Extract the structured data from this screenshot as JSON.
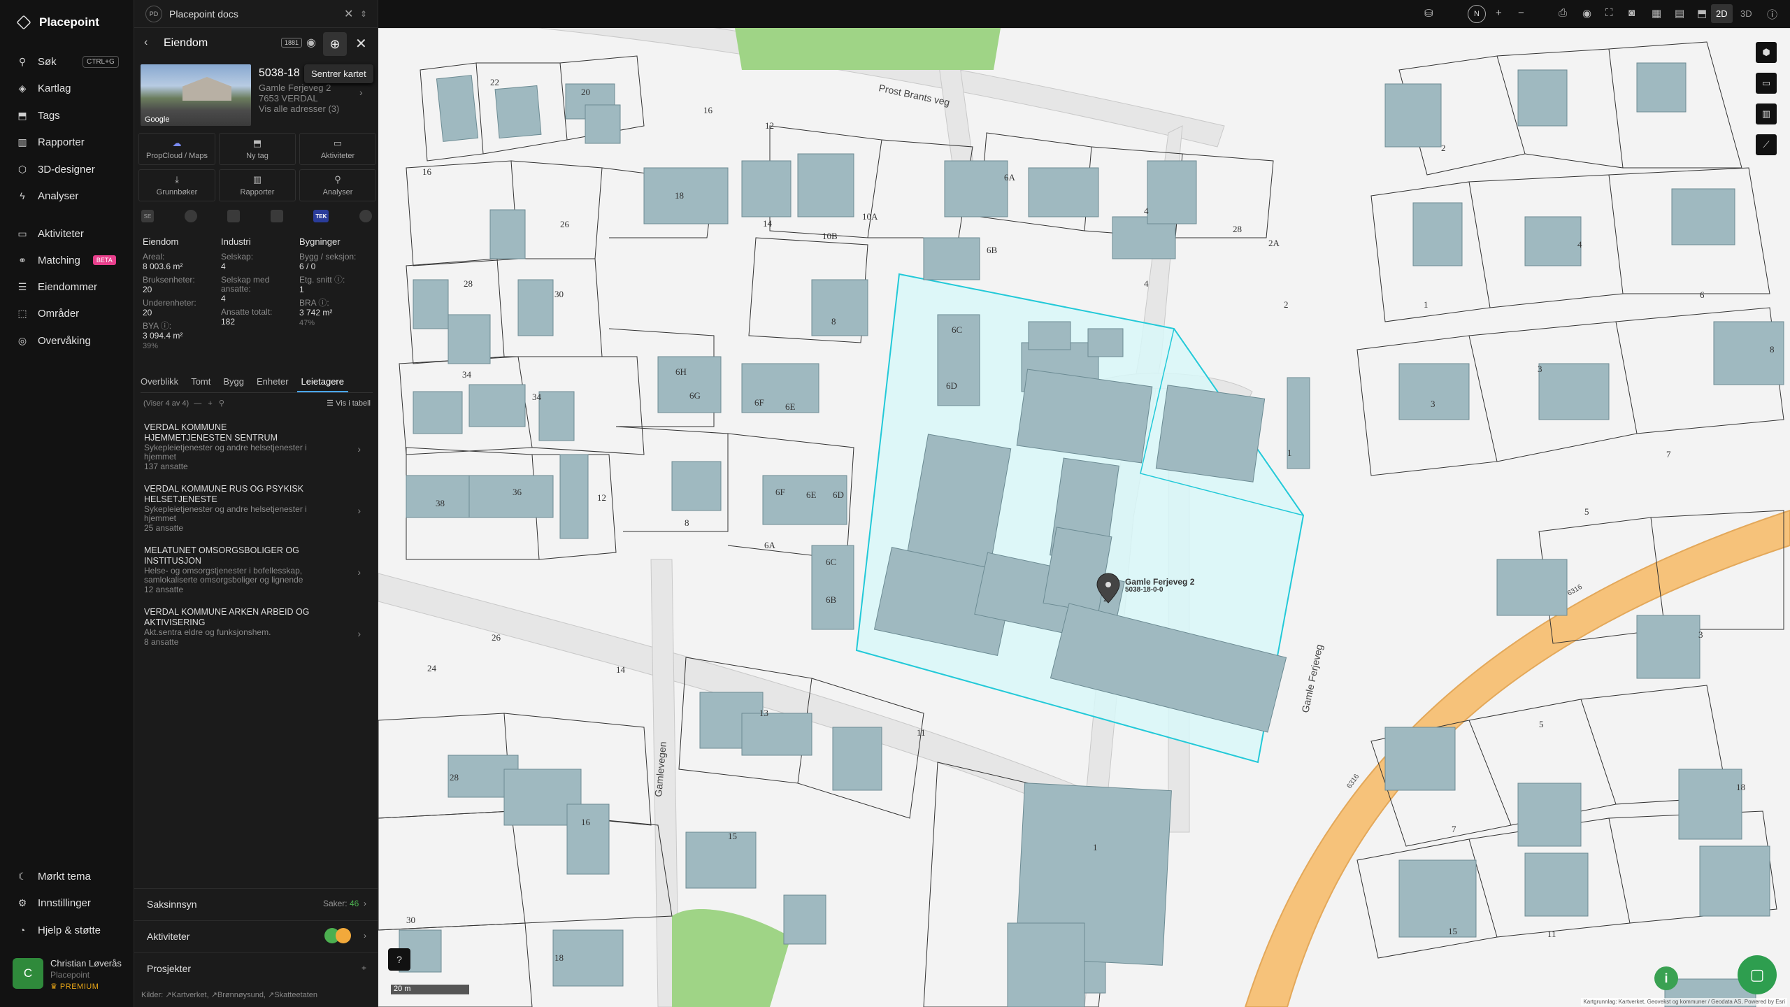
{
  "app": {
    "name": "Placepoint"
  },
  "nav": {
    "items": [
      {
        "label": "Søk",
        "shortcut": "CTRL+G"
      },
      {
        "label": "Kartlag"
      },
      {
        "label": "Tags"
      },
      {
        "label": "Rapporter"
      },
      {
        "label": "3D-designer"
      },
      {
        "label": "Analyser"
      },
      {
        "label": "Aktiviteter"
      },
      {
        "label": "Matching",
        "badge": "BETA"
      },
      {
        "label": "Eiendommer"
      },
      {
        "label": "Områder"
      },
      {
        "label": "Overvåking"
      }
    ],
    "bottom": [
      {
        "label": "Mørkt tema"
      },
      {
        "label": "Innstillinger"
      },
      {
        "label": "Hjelp & støtte"
      }
    ],
    "user": {
      "initial": "C",
      "name": "Christian Løverås",
      "org": "Placepoint",
      "tier": "PREMIUM"
    }
  },
  "workspace": {
    "initials": "PD",
    "title": "Placepoint docs"
  },
  "panel": {
    "title": "Eiendom",
    "badge": "1881",
    "tooltip": "Sentrer kartet",
    "photo_credit": "Google",
    "property": {
      "id": "5038-18",
      "address": "Gamle Ferjeveg 2",
      "postal": "7653 VERDAL",
      "all_addresses": "Vis alle adresser (3)"
    },
    "actions": [
      {
        "label": "PropCloud / Maps",
        "icon": "☁"
      },
      {
        "label": "Ny tag",
        "icon": "⬒"
      },
      {
        "label": "Aktiviteter",
        "icon": "▭"
      },
      {
        "label": "Grunnbøker",
        "icon": "⤓"
      },
      {
        "label": "Rapporter",
        "icon": "▥"
      },
      {
        "label": "Analyser",
        "icon": "⚲"
      }
    ],
    "logos": [
      "SE",
      "",
      "",
      "",
      "TEK",
      ""
    ],
    "stats": {
      "col1": {
        "head": "Eiendom",
        "rows": [
          {
            "k": "Areal:",
            "v": "8 003.6 m²"
          },
          {
            "k": "Bruksenheter:",
            "v": "20"
          },
          {
            "k": "Underenheter:",
            "v": "20"
          },
          {
            "k": "BYA ⓘ:",
            "v": "3 094.4 m²",
            "p": "39%"
          }
        ]
      },
      "col2": {
        "head": "Industri",
        "rows": [
          {
            "k": "Selskap:",
            "v": "4"
          },
          {
            "k": "Selskap med ansatte:",
            "v": "4"
          },
          {
            "k": "Ansatte totalt:",
            "v": "182"
          }
        ]
      },
      "col3": {
        "head": "Bygninger",
        "rows": [
          {
            "k": "Bygg / seksjon:",
            "v": "6 / 0"
          },
          {
            "k": "Etg. snitt ⓘ:",
            "v": "1"
          },
          {
            "k": "BRA ⓘ:",
            "v": "3 742 m²",
            "p": "47%"
          }
        ]
      }
    },
    "tabs": [
      "Overblikk",
      "Tomt",
      "Bygg",
      "Enheter",
      "Leietagere"
    ],
    "active_tab": "Leietagere",
    "tenant_count": "(Viser 4 av 4)",
    "table_label": "Vis i tabell",
    "tenants": [
      {
        "name": "VERDAL KOMMUNE HJEMMETJENESTEN SENTRUM",
        "desc": "Sykepleietjenester og andre helsetjenester i hjemmet",
        "count": "137 ansatte"
      },
      {
        "name": "VERDAL KOMMUNE RUS OG PSYKISK HELSETJENESTE",
        "desc": "Sykepleietjenester og andre helsetjenester i hjemmet",
        "count": "25 ansatte"
      },
      {
        "name": "MELATUNET OMSORGSBOLIGER OG INSTITUSJON",
        "desc": "Helse- og omsorgstjenester i bofellesskap, samlokaliserte omsorgsboliger og lignende",
        "count": "12 ansatte"
      },
      {
        "name": "VERDAL KOMMUNE ARKEN ARBEID OG AKTIVISERING",
        "desc": "Akt.sentra eldre og funksjonshem.",
        "count": "8 ansatte"
      }
    ],
    "sections": {
      "saksinnsyn": {
        "label": "Saksinnsyn",
        "right": "Saker:",
        "count": "46"
      },
      "aktiviteter": {
        "label": "Aktiviteter"
      },
      "prosjekter": {
        "label": "Prosjekter",
        "right": "+"
      }
    },
    "sources": "Kilder: ↗Kartverket, ↗Brønnøysund, ↗Skatteetaten"
  },
  "map": {
    "view_2d": "2D",
    "view_3d": "3D",
    "north": "N",
    "scale": "20 m",
    "pin_label_1": "Gamle Ferjeveg 2",
    "pin_label_2": "5038-18-0-0",
    "roads": [
      "Prost Brants veg",
      "Gamle Ferjeveg",
      "Gamlevegen",
      "6316",
      "6316"
    ],
    "attribution": "Kartgrunnlag: Kartverket, Geovekst og kommuner / Geodata AS, Powered by Esri",
    "building_labels": [
      "22",
      "20",
      "16",
      "12",
      "16",
      "26",
      "18",
      "14",
      "10A",
      "10B",
      "6A",
      "6B",
      "4",
      "4",
      "28",
      "2A",
      "2",
      "30",
      "28",
      "8",
      "6C",
      "6D",
      "6H",
      "6G",
      "6F",
      "6E",
      "34",
      "34",
      "38",
      "36",
      "12",
      "8",
      "6F",
      "6E",
      "6D",
      "6C",
      "6B",
      "6A",
      "26",
      "24",
      "14",
      "28",
      "16",
      "13",
      "15",
      "11",
      "18",
      "30",
      "1",
      "1",
      "2",
      "4",
      "6",
      "8",
      "1",
      "3",
      "3",
      "7",
      "5",
      "3",
      "5",
      "7",
      "18",
      "15",
      "11",
      "2"
    ],
    "colors": {
      "parcel": "#22c9d8",
      "building": "#8fb3bd",
      "road": "#f6c27a",
      "green": "#9fd486"
    }
  }
}
